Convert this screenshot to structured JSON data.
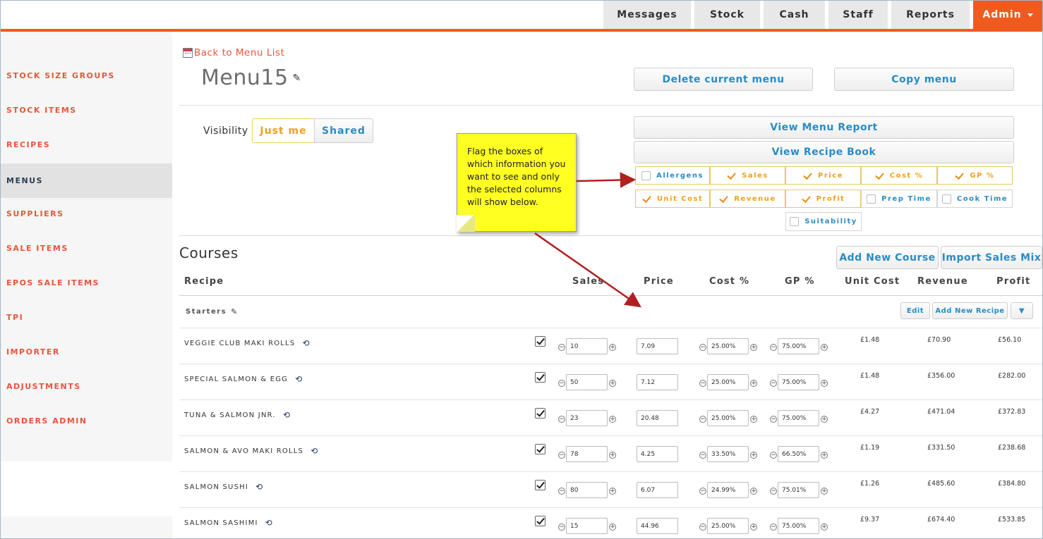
{
  "nav": {
    "tabs": [
      {
        "label": "Messages"
      },
      {
        "label": "Stock"
      },
      {
        "label": "Cash"
      },
      {
        "label": "Staff"
      },
      {
        "label": "Reports"
      },
      {
        "label": "Admin"
      }
    ]
  },
  "sidebar": {
    "items": [
      {
        "label": "STOCK SIZE GROUPS"
      },
      {
        "label": "STOCK ITEMS"
      },
      {
        "label": "RECIPES"
      },
      {
        "label": "MENUS"
      },
      {
        "label": "SUPPLIERS"
      },
      {
        "label": "SALE ITEMS"
      },
      {
        "label": "EPOS SALE ITEMS"
      },
      {
        "label": "TPI"
      },
      {
        "label": "IMPORTER"
      },
      {
        "label": "ADJUSTMENTS"
      },
      {
        "label": "ORDERS ADMIN"
      }
    ],
    "active": "MENUS"
  },
  "page": {
    "back_link": "Back to Menu List",
    "title": "Menu15",
    "delete_button": "Delete current menu",
    "copy_button": "Copy menu",
    "visibility_label": "Visibility",
    "visibility_options": [
      "Just me",
      "Shared"
    ],
    "visibility_selected": "Just me",
    "view_menu_report": "View Menu Report",
    "view_recipe_book": "View Recipe Book"
  },
  "column_toggles": [
    {
      "label": "Allergens",
      "checked": false
    },
    {
      "label": "Sales",
      "checked": true
    },
    {
      "label": "Price",
      "checked": true
    },
    {
      "label": "Cost %",
      "checked": true
    },
    {
      "label": "GP %",
      "checked": true
    },
    {
      "label": "Unit Cost",
      "checked": true
    },
    {
      "label": "Revenue",
      "checked": true
    },
    {
      "label": "Profit",
      "checked": true
    },
    {
      "label": "Prep Time",
      "checked": false
    },
    {
      "label": "Cook Time",
      "checked": false
    },
    {
      "label": "Suitability",
      "checked": false
    }
  ],
  "note": {
    "text": "Flag the boxes of which information you want to see and only the selected columns will show below."
  },
  "courses": {
    "title": "Courses",
    "add_course_button": "Add New Course",
    "import_button": "Import Sales Mix",
    "headers": [
      "Recipe",
      "Sales",
      "Price",
      "Cost %",
      "GP %",
      "Unit Cost",
      "Revenue",
      "Profit"
    ],
    "section": {
      "name": "Starters",
      "edit_button": "Edit",
      "add_recipe_button": "Add New Recipe",
      "dropdown_glyph": "▼"
    },
    "rows": [
      {
        "name": "VEGGIE CLUB MAKI ROLLS",
        "sales": "10",
        "price": "7.09",
        "cost_pct": "25.00%",
        "gp_pct": "75.00%",
        "unit_cost": "£1.48",
        "revenue": "£70.90",
        "profit": "£56.10"
      },
      {
        "name": "SPECIAL SALMON & EGG",
        "sales": "50",
        "price": "7.12",
        "cost_pct": "25.00%",
        "gp_pct": "75.00%",
        "unit_cost": "£1.48",
        "revenue": "£356.00",
        "profit": "£282.00"
      },
      {
        "name": "TUNA & SALMON JNR.",
        "sales": "23",
        "price": "20.48",
        "cost_pct": "25.00%",
        "gp_pct": "75.00%",
        "unit_cost": "£4.27",
        "revenue": "£471.04",
        "profit": "£372.83"
      },
      {
        "name": "SALMON & AVO MAKI ROLLS",
        "sales": "78",
        "price": "4.25",
        "cost_pct": "33.50%",
        "gp_pct": "66.50%",
        "unit_cost": "£1.19",
        "revenue": "£331.50",
        "profit": "£238.68"
      },
      {
        "name": "SALMON SUSHI",
        "sales": "80",
        "price": "6.07",
        "cost_pct": "24.99%",
        "gp_pct": "75.01%",
        "unit_cost": "£1.26",
        "revenue": "£485.60",
        "profit": "£384.80"
      },
      {
        "name": "SALMON SASHIMI",
        "sales": "15",
        "price": "44.96",
        "cost_pct": "25.00%",
        "gp_pct": "75.00%",
        "unit_cost": "£9.37",
        "revenue": "£674.40",
        "profit": "£533.85"
      }
    ]
  },
  "colors": {
    "accent": "#f05a1e",
    "link": "#e8553a",
    "button_text": "#2a8cc4",
    "toggle_checked": "#f0a020",
    "note_bg": "#ffff22",
    "arrow": "#b02020"
  }
}
